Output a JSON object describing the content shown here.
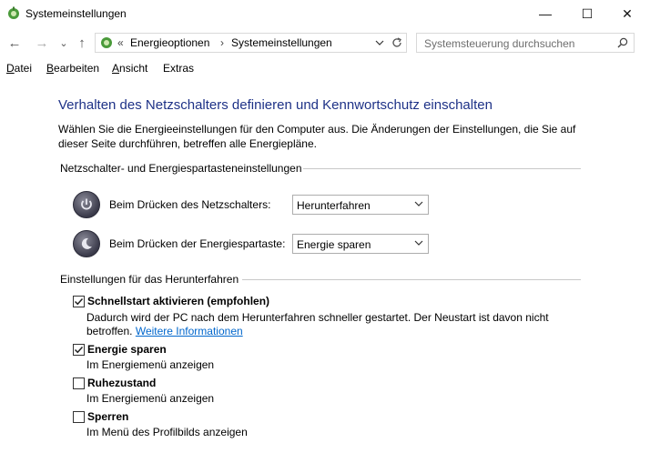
{
  "window": {
    "title": "Systemeinstellungen",
    "minimize_glyph": "—",
    "maximize_glyph": "☐",
    "close_glyph": "✕"
  },
  "nav": {
    "back_glyph": "←",
    "forward_glyph": "→",
    "recent_glyph": "⌄",
    "up_glyph": "↑"
  },
  "address": {
    "overflow": "«",
    "crumbs": [
      "Energieoptionen",
      "Systemeinstellungen"
    ],
    "separator": "›"
  },
  "search": {
    "placeholder": "Systemsteuerung durchsuchen"
  },
  "menu": [
    {
      "mnemonic": "D",
      "rest": "atei"
    },
    {
      "mnemonic": "B",
      "rest": "earbeiten"
    },
    {
      "mnemonic": "A",
      "rest": "nsicht"
    },
    {
      "mnemonic": "",
      "rest": "Extras"
    }
  ],
  "page": {
    "heading": "Verhalten des Netzschalters definieren und Kennwortschutz einschalten",
    "description": "Wählen Sie die Energieeinstellungen für den Computer aus. Die Änderungen der Einstellungen, die Sie auf dieser Seite durchführen, betreffen alle Energiepläne."
  },
  "power_section": {
    "title": "Netzschalter- und Energiespartasteneinstellungen",
    "rows": [
      {
        "label": "Beim Drücken des Netzschalters:",
        "value": "Herunterfahren",
        "icon": "power-button-icon"
      },
      {
        "label": "Beim Drücken der Energiespartaste:",
        "value": "Energie sparen",
        "icon": "sleep-button-icon"
      }
    ]
  },
  "shutdown_section": {
    "title": "Einstellungen für das Herunterfahren",
    "items": [
      {
        "label": "Schnellstart aktivieren (empfohlen)",
        "checked": true,
        "desc": "Dadurch wird der PC nach dem Herunterfahren schneller gestartet. Der Neustart ist davon nicht betroffen.",
        "link": "Weitere Informationen"
      },
      {
        "label": "Energie sparen",
        "checked": true,
        "desc": "Im Energiemenü anzeigen"
      },
      {
        "label": "Ruhezustand",
        "checked": false,
        "desc": "Im Energiemenü anzeigen"
      },
      {
        "label": "Sperren",
        "checked": false,
        "desc": "Im Menü des Profilbilds anzeigen"
      }
    ]
  },
  "colors": {
    "heading": "#1e3287",
    "link": "#0066cc"
  }
}
